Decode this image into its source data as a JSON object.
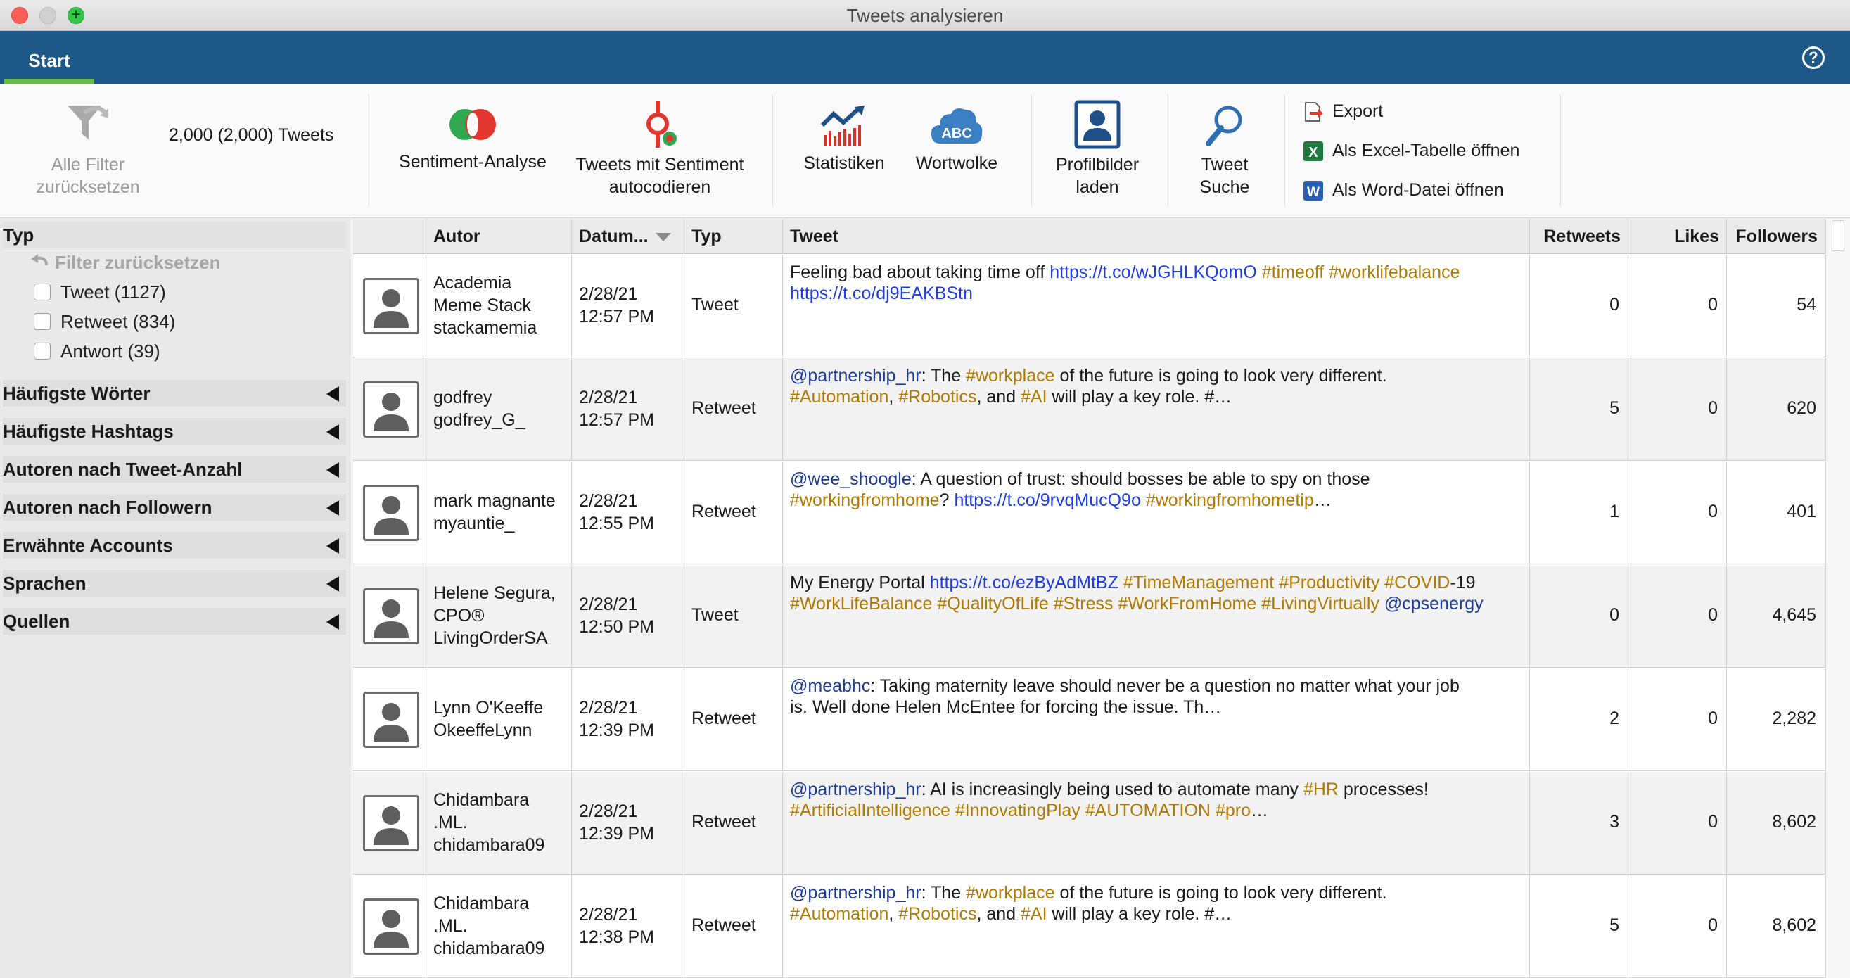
{
  "window": {
    "title": "Tweets analysieren"
  },
  "tabs": [
    {
      "label": "Start",
      "active": true
    }
  ],
  "help": {
    "icon": "question-icon",
    "glyph": "?"
  },
  "ribbon": {
    "reset": {
      "label_line1": "Alle Filter",
      "label_line2": "zurücksetzen",
      "icon": "filter-reset-icon"
    },
    "tweet_count": "2,000 (2,000) Tweets",
    "sentiment": {
      "label": "Sentiment-Analyse",
      "icon": "sentiment-icon"
    },
    "autocode": {
      "label_line1": "Tweets mit Sentiment",
      "label_line2": "autocodieren",
      "icon": "autocode-icon"
    },
    "stats": {
      "label": "Statistiken",
      "icon": "statistics-icon"
    },
    "wordcloud": {
      "label": "Wortwolke",
      "icon": "word-cloud-icon",
      "glyph": "ABC"
    },
    "profile": {
      "label_line1": "Profilbilder",
      "label_line2": "laden",
      "icon": "profile-image-icon"
    },
    "search": {
      "label_line1": "Tweet",
      "label_line2": "Suche",
      "icon": "search-icon"
    },
    "export": {
      "label": "Export",
      "icon": "export-icon"
    },
    "excel": {
      "label": "Als Excel-Tabelle öffnen",
      "icon": "excel-icon",
      "glyph": "X"
    },
    "word": {
      "label": "Als Word-Datei öffnen",
      "icon": "word-icon",
      "glyph": "W"
    }
  },
  "filters": {
    "typ": {
      "title": "Typ",
      "reset": "Filter zurücksetzen",
      "options": [
        {
          "label": "Tweet (1127)",
          "checked": false
        },
        {
          "label": "Retweet (834)",
          "checked": false
        },
        {
          "label": "Antwort (39)",
          "checked": false
        }
      ]
    },
    "sections": [
      {
        "title": "Häufigste Wörter"
      },
      {
        "title": "Häufigste Hashtags"
      },
      {
        "title": "Autoren nach Tweet-Anzahl"
      },
      {
        "title": "Autoren nach Followern"
      },
      {
        "title": "Erwähnte Accounts"
      },
      {
        "title": "Sprachen"
      },
      {
        "title": "Quellen"
      }
    ]
  },
  "table": {
    "columns": {
      "author": "Autor",
      "date": "Datum...",
      "type": "Typ",
      "tweet": "Tweet",
      "retweets": "Retweets",
      "likes": "Likes",
      "followers": "Followers"
    },
    "rows": [
      {
        "author": [
          "Academia",
          "Meme Stack",
          "stackamemia"
        ],
        "date": [
          "2/28/21",
          "12:57 PM"
        ],
        "type": "Tweet",
        "tweet": [
          [
            {
              "t": "n",
              "v": "Feeling bad about taking time off "
            },
            {
              "t": "l",
              "v": "https://t.co/wJGHLKQomO"
            },
            {
              "t": "n",
              "v": " "
            },
            {
              "t": "h",
              "v": "#timeoff"
            },
            {
              "t": "n",
              "v": " "
            },
            {
              "t": "h",
              "v": "#worklifebalance"
            }
          ],
          [
            {
              "t": "l",
              "v": "https://t.co/dj9EAKBStn"
            }
          ]
        ],
        "retweets": "0",
        "likes": "0",
        "followers": "54"
      },
      {
        "author": [
          "godfrey",
          "godfrey_G_"
        ],
        "date": [
          "2/28/21",
          "12:57 PM"
        ],
        "type": "Retweet",
        "tweet": [
          [
            {
              "t": "m",
              "v": "@partnership_hr"
            },
            {
              "t": "n",
              "v": ": The "
            },
            {
              "t": "h",
              "v": "#workplace"
            },
            {
              "t": "n",
              "v": " of the future is going to look very different."
            }
          ],
          [
            {
              "t": "h",
              "v": "#Automation"
            },
            {
              "t": "n",
              "v": ", "
            },
            {
              "t": "h",
              "v": "#Robotics"
            },
            {
              "t": "n",
              "v": ", and "
            },
            {
              "t": "h",
              "v": "#AI"
            },
            {
              "t": "n",
              "v": " will play a key role. #…"
            }
          ]
        ],
        "retweets": "5",
        "likes": "0",
        "followers": "620"
      },
      {
        "author": [
          "mark magnante",
          "myauntie_"
        ],
        "date": [
          "2/28/21",
          "12:55 PM"
        ],
        "type": "Retweet",
        "tweet": [
          [
            {
              "t": "m",
              "v": "@wee_shoogle"
            },
            {
              "t": "n",
              "v": ": A question of trust: should bosses be able to spy on those"
            }
          ],
          [
            {
              "t": "h",
              "v": "#workingfromhome"
            },
            {
              "t": "n",
              "v": "? "
            },
            {
              "t": "l",
              "v": "https://t.co/9rvqMucQ9o"
            },
            {
              "t": "n",
              "v": " "
            },
            {
              "t": "h",
              "v": "#workingfromhometip"
            },
            {
              "t": "n",
              "v": "…"
            }
          ]
        ],
        "retweets": "1",
        "likes": "0",
        "followers": "401"
      },
      {
        "author": [
          "Helene Segura,",
          "CPO®",
          "LivingOrderSA"
        ],
        "date": [
          "2/28/21",
          "12:50 PM"
        ],
        "type": "Tweet",
        "tweet": [
          [
            {
              "t": "n",
              "v": "My Energy Portal "
            },
            {
              "t": "l",
              "v": "https://t.co/ezByAdMtBZ"
            },
            {
              "t": "n",
              "v": " "
            },
            {
              "t": "h",
              "v": "#TimeManagement"
            },
            {
              "t": "n",
              "v": " "
            },
            {
              "t": "h",
              "v": "#Productivity"
            },
            {
              "t": "n",
              "v": " "
            },
            {
              "t": "h",
              "v": "#COVID"
            },
            {
              "t": "n",
              "v": "-19"
            }
          ],
          [
            {
              "t": "h",
              "v": "#WorkLifeBalance"
            },
            {
              "t": "n",
              "v": " "
            },
            {
              "t": "h",
              "v": "#QualityOfLife"
            },
            {
              "t": "n",
              "v": " "
            },
            {
              "t": "h",
              "v": "#Stress"
            },
            {
              "t": "n",
              "v": " "
            },
            {
              "t": "h",
              "v": "#WorkFromHome"
            },
            {
              "t": "n",
              "v": " "
            },
            {
              "t": "h",
              "v": "#LivingVirtually"
            },
            {
              "t": "n",
              "v": " "
            },
            {
              "t": "m",
              "v": "@cpsenergy"
            }
          ]
        ],
        "retweets": "0",
        "likes": "0",
        "followers": "4,645"
      },
      {
        "author": [
          "Lynn O'Keeffe",
          "OkeeffeLynn"
        ],
        "date": [
          "2/28/21",
          "12:39 PM"
        ],
        "type": "Retweet",
        "tweet": [
          [
            {
              "t": "m",
              "v": "@meabhc"
            },
            {
              "t": "n",
              "v": ": Taking maternity leave should never be a question no matter what your job"
            }
          ],
          [
            {
              "t": "n",
              "v": "is. Well done Helen McEntee for forcing the issue. Th…"
            }
          ]
        ],
        "retweets": "2",
        "likes": "0",
        "followers": "2,282"
      },
      {
        "author": [
          "Chidambara",
          ".ML.",
          "chidambara09"
        ],
        "date": [
          "2/28/21",
          "12:39 PM"
        ],
        "type": "Retweet",
        "tweet": [
          [
            {
              "t": "m",
              "v": "@partnership_hr"
            },
            {
              "t": "n",
              "v": ": AI is increasingly being used to automate many "
            },
            {
              "t": "h",
              "v": "#HR"
            },
            {
              "t": "n",
              "v": " processes!"
            }
          ],
          [
            {
              "t": "h",
              "v": "#ArtificialIntelligence"
            },
            {
              "t": "n",
              "v": " "
            },
            {
              "t": "h",
              "v": "#InnovatingPlay"
            },
            {
              "t": "n",
              "v": " "
            },
            {
              "t": "h",
              "v": "#AUTOMATION"
            },
            {
              "t": "n",
              "v": " "
            },
            {
              "t": "h",
              "v": "#pro"
            },
            {
              "t": "n",
              "v": "…"
            }
          ]
        ],
        "retweets": "3",
        "likes": "0",
        "followers": "8,602"
      },
      {
        "author": [
          "Chidambara",
          ".ML.",
          "chidambara09"
        ],
        "date": [
          "2/28/21",
          "12:38 PM"
        ],
        "type": "Retweet",
        "tweet": [
          [
            {
              "t": "m",
              "v": "@partnership_hr"
            },
            {
              "t": "n",
              "v": ": The "
            },
            {
              "t": "h",
              "v": "#workplace"
            },
            {
              "t": "n",
              "v": " of the future is going to look very different."
            }
          ],
          [
            {
              "t": "h",
              "v": "#Automation"
            },
            {
              "t": "n",
              "v": ", "
            },
            {
              "t": "h",
              "v": "#Robotics"
            },
            {
              "t": "n",
              "v": ", and "
            },
            {
              "t": "h",
              "v": "#AI"
            },
            {
              "t": "n",
              "v": " will play a key role. #…"
            }
          ]
        ],
        "retweets": "5",
        "likes": "0",
        "followers": "8,602"
      }
    ]
  },
  "colors": {
    "header_blue": "#1e5888",
    "tab_underline": "#67b949",
    "mention": "#1d3c9a",
    "link": "#1e3de8",
    "hashtag": "#b17a00"
  }
}
